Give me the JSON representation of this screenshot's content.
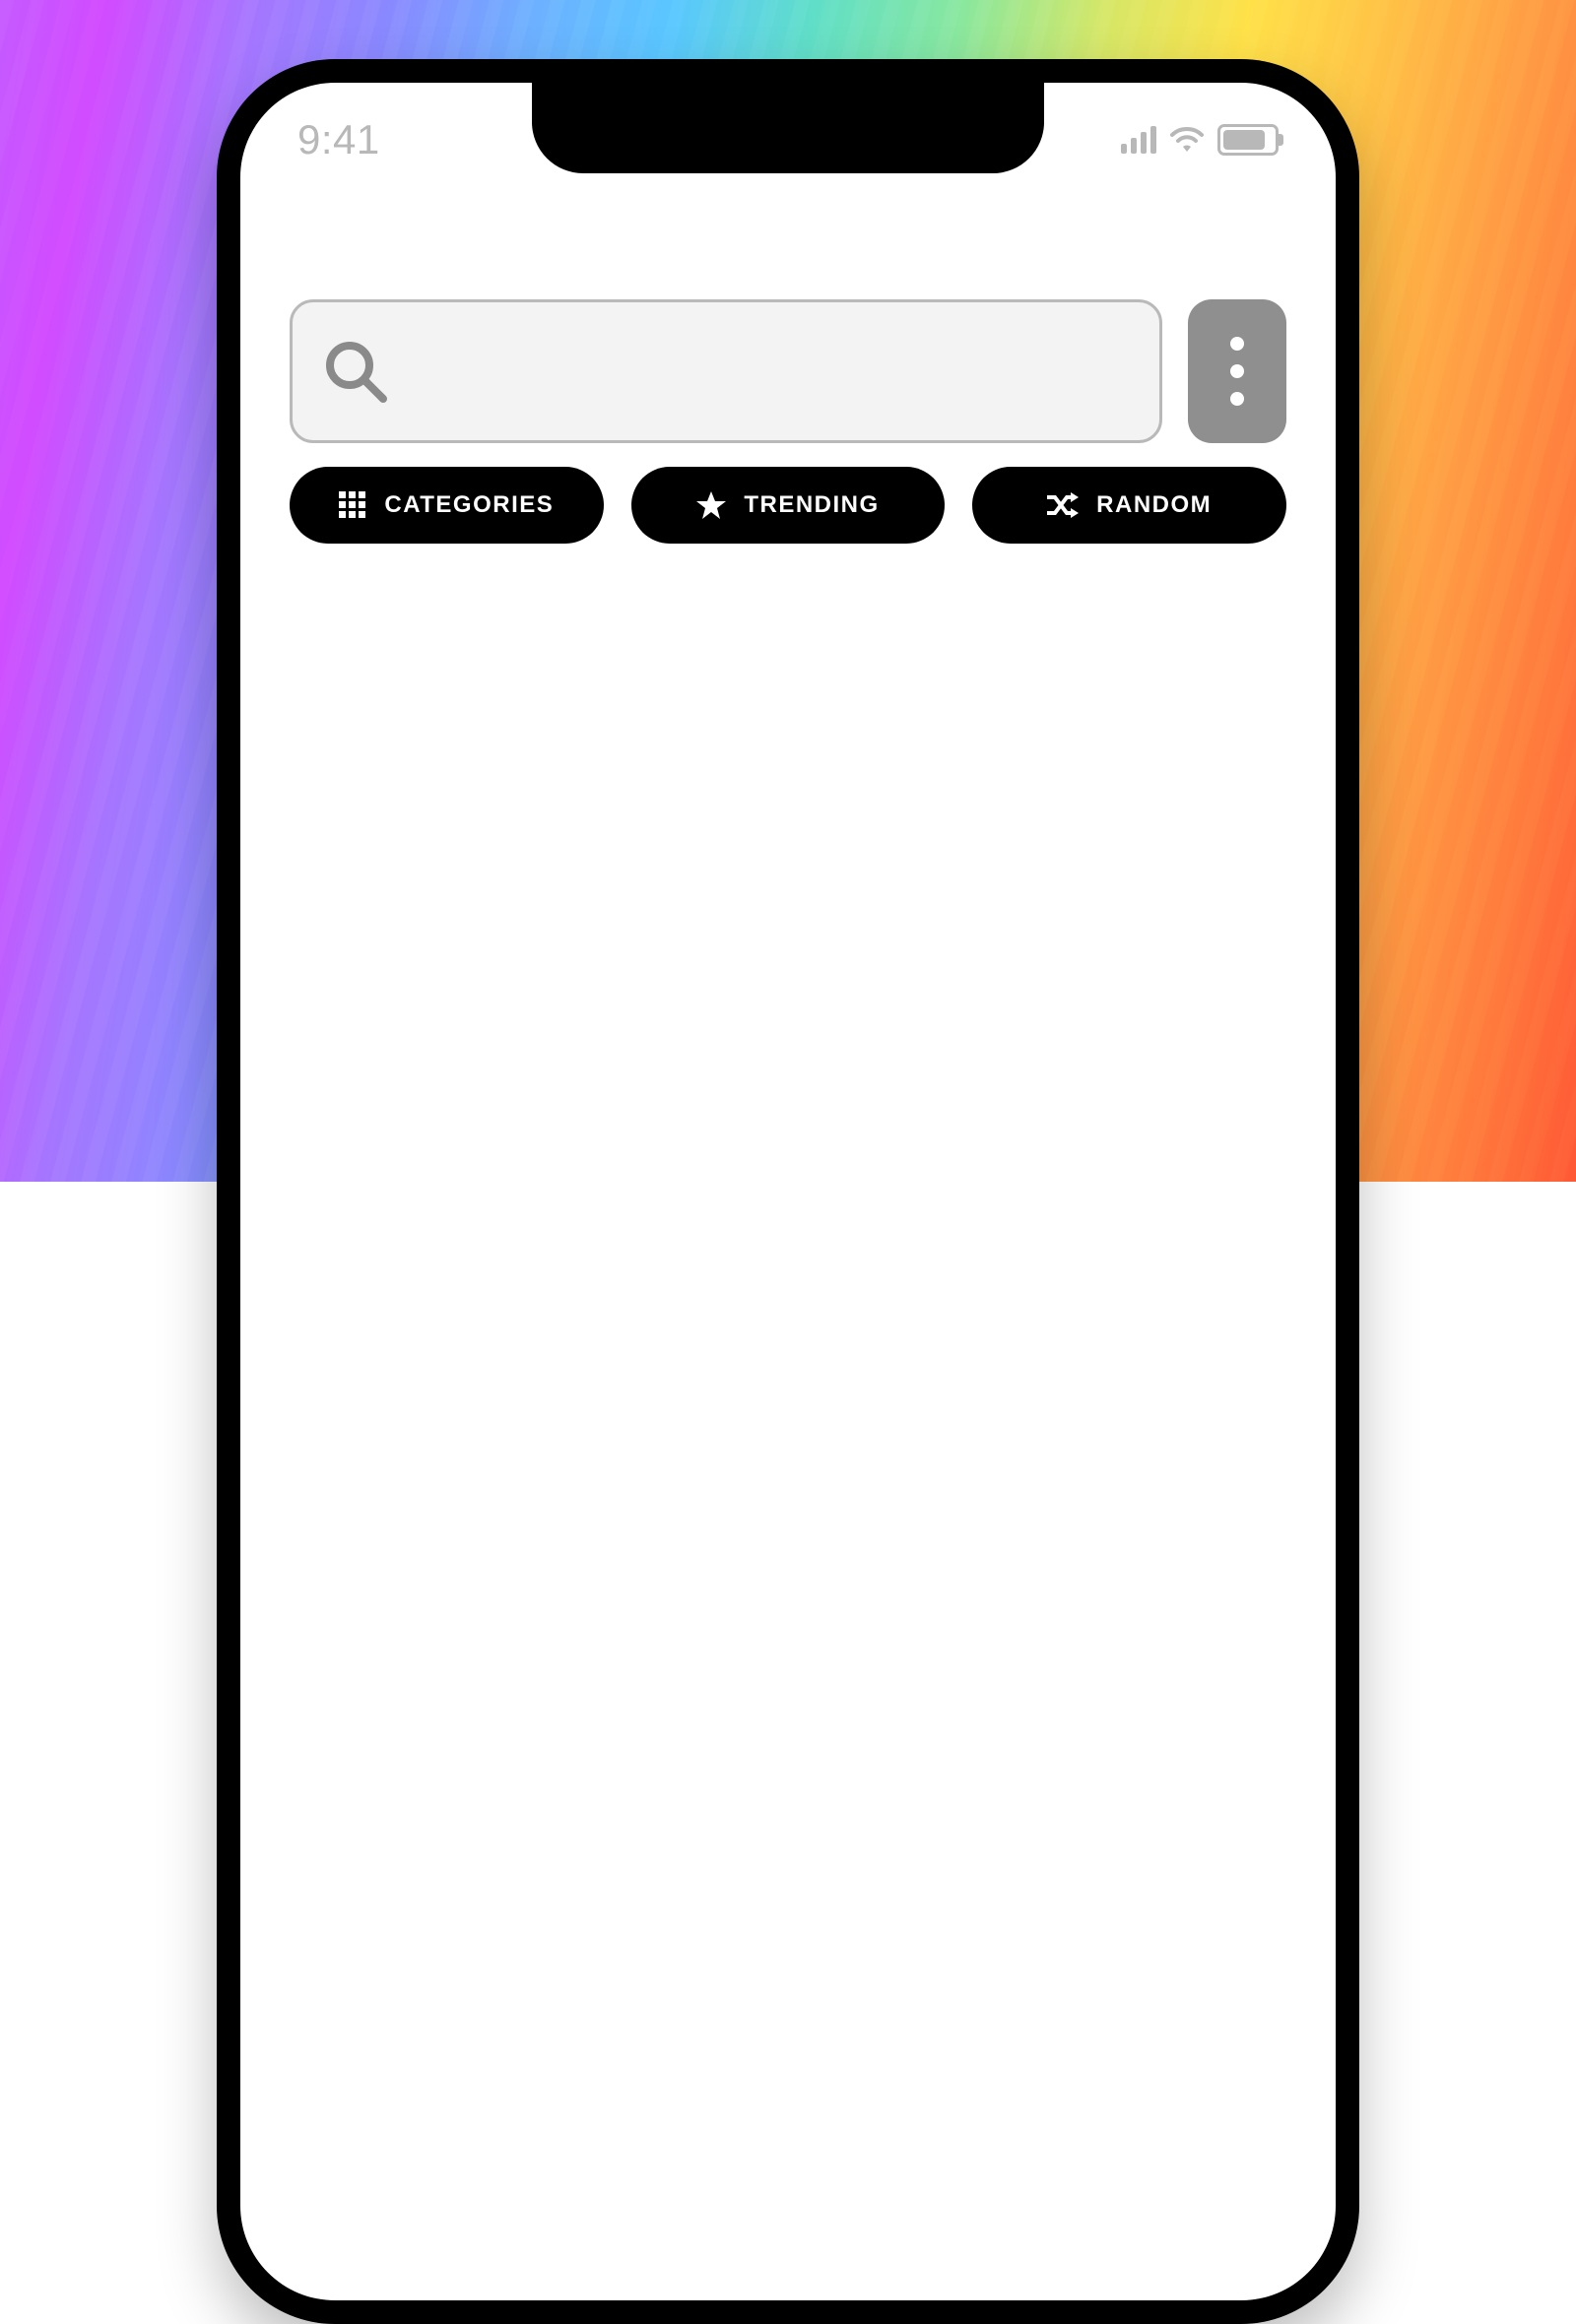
{
  "statusbar": {
    "time": "9:41"
  },
  "search": {
    "placeholder": ""
  },
  "pills": {
    "categories": "CATEGORIES",
    "trending": "TRENDING",
    "random": "RANDOM"
  }
}
